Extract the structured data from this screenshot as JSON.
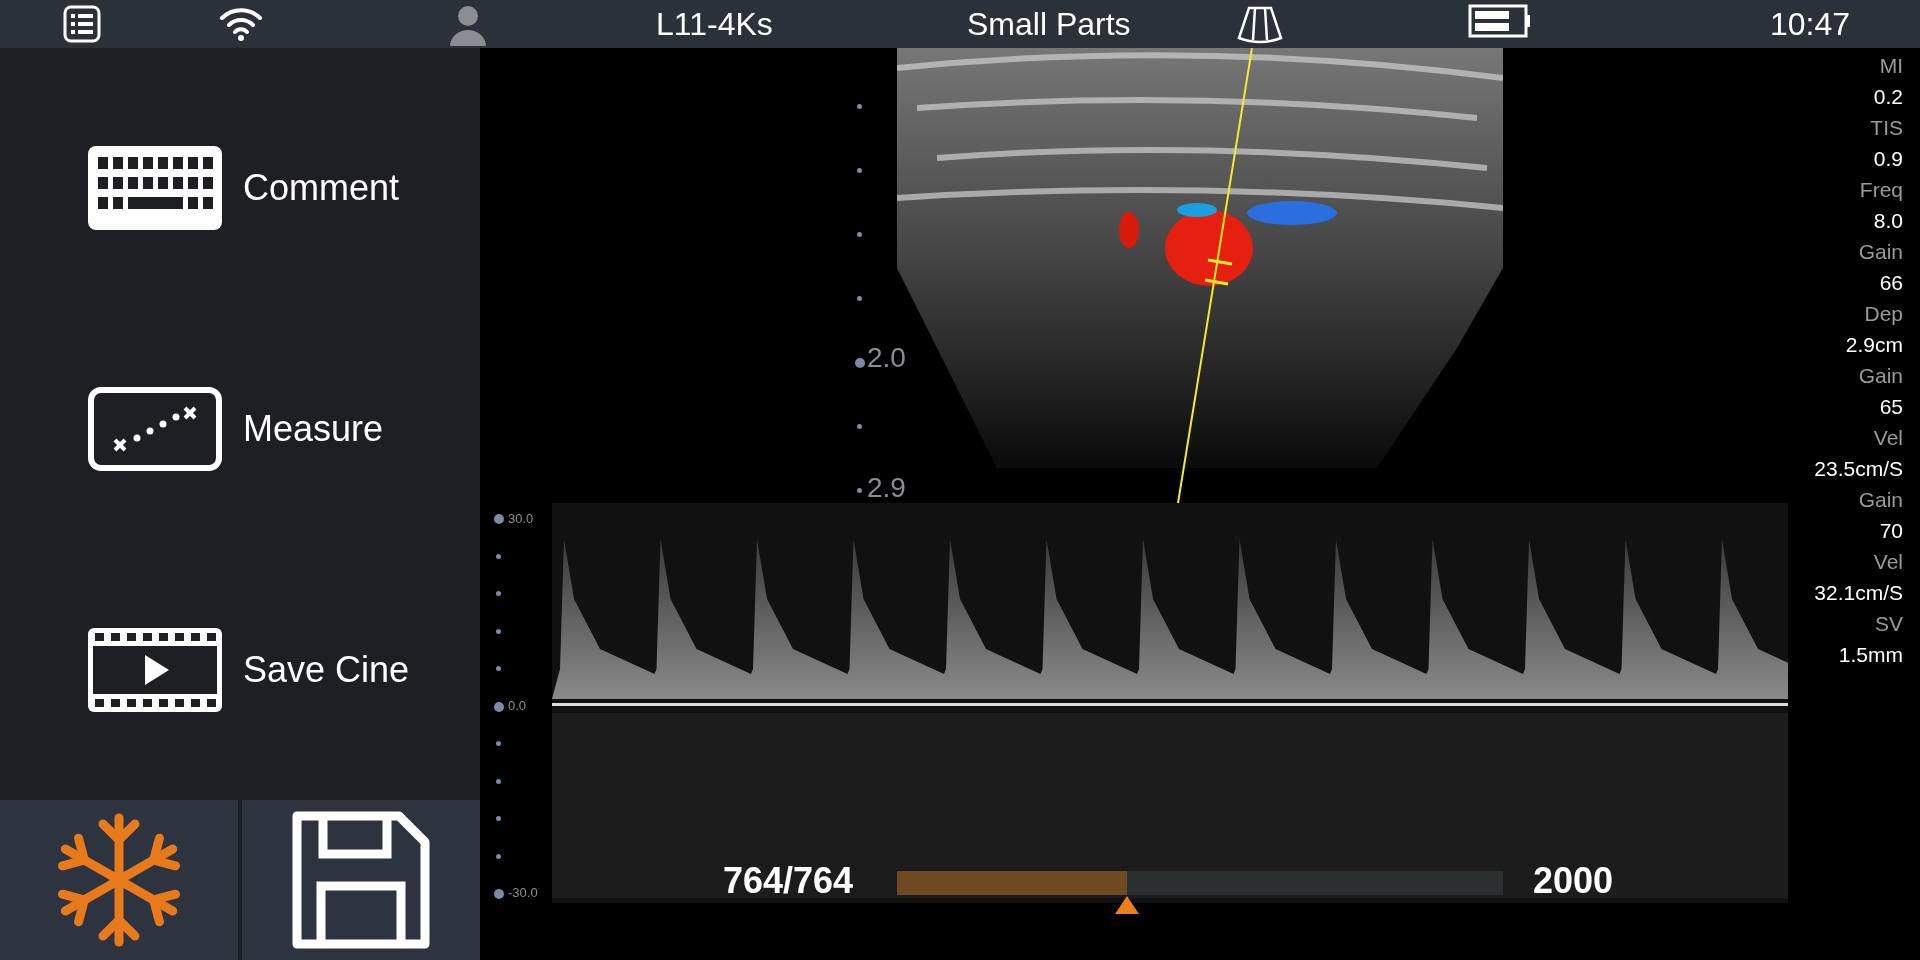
{
  "status_bar": {
    "probe": "L11-4Ks",
    "preset": "Small Parts",
    "time": "10:47"
  },
  "actions": [
    {
      "kind": "keyboard",
      "label": "Comment"
    },
    {
      "kind": "measure",
      "label": "Measure"
    },
    {
      "kind": "film",
      "label": "Save Cine"
    }
  ],
  "bottom_buttons": [
    {
      "kind": "freeze"
    },
    {
      "kind": "save"
    }
  ],
  "depth_scale": [
    "2.0",
    "2.9"
  ],
  "velocity_scale": [
    "30.0",
    "0.0",
    "-30.0"
  ],
  "parameters": [
    {
      "label": "MI",
      "value": "0.2"
    },
    {
      "label": "TIS",
      "value": "0.9"
    },
    {
      "label": "Freq",
      "value": "8.0"
    },
    {
      "label": "Gain",
      "value": "66"
    },
    {
      "label": "Dep",
      "value": "2.9cm"
    },
    {
      "label": "Gain",
      "value": "65"
    },
    {
      "label": "Vel",
      "value": "23.5cm/S"
    },
    {
      "label": "Gain",
      "value": "70"
    },
    {
      "label": "Vel",
      "value": "32.1cm/S"
    },
    {
      "label": "SV",
      "value": "1.5mm"
    }
  ],
  "cine": {
    "frame": "764/764",
    "level": 0.38,
    "total": "2000"
  }
}
